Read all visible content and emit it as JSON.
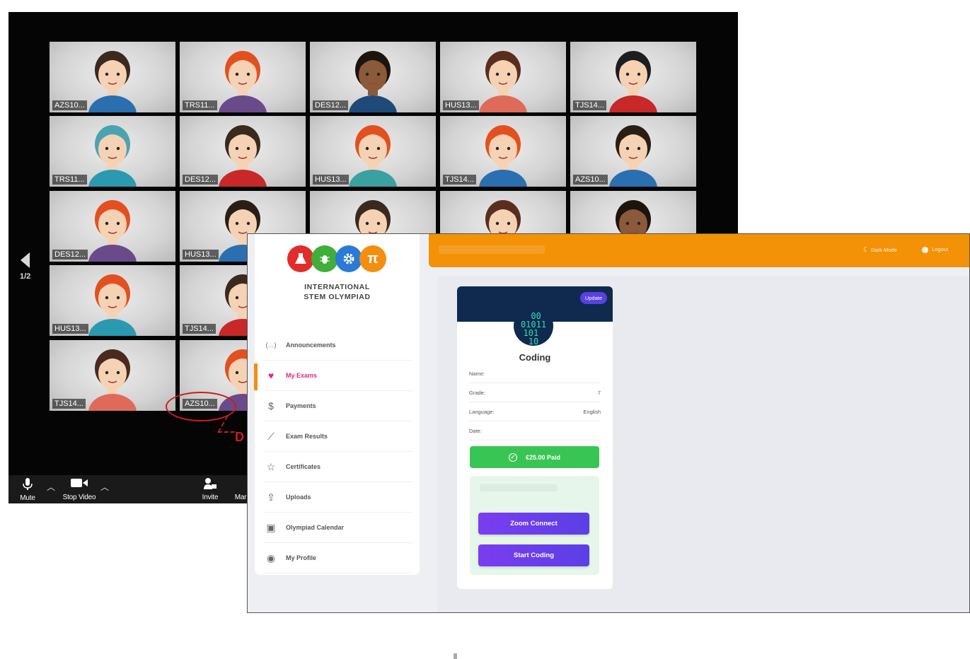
{
  "zoom": {
    "page_indicator": "1/2",
    "participants": [
      {
        "label": "AZS10..."
      },
      {
        "label": "TRS11..."
      },
      {
        "label": "DES12..."
      },
      {
        "label": "HUS13..."
      },
      {
        "label": "TJS14..."
      },
      {
        "label": "TRS11..."
      },
      {
        "label": "DES12..."
      },
      {
        "label": "HUS13..."
      },
      {
        "label": "TJS14..."
      },
      {
        "label": "AZS10..."
      },
      {
        "label": "DES12..."
      },
      {
        "label": "HUS13..."
      },
      {
        "label": ""
      },
      {
        "label": ""
      },
      {
        "label": ""
      },
      {
        "label": "HUS13..."
      },
      {
        "label": "TJS14..."
      },
      {
        "label": "TJS14..."
      },
      {
        "label": "AZS10..."
      }
    ],
    "annotation_letter": "D",
    "toolbar": {
      "mute": "Mute",
      "stop_video": "Stop Video",
      "invite": "Invite",
      "manage": "Mar"
    }
  },
  "portal": {
    "org_line1": "INTERNATIONAL",
    "org_line2": "STEM OLYMPIAD",
    "logo_pi": "π",
    "menu": [
      {
        "label": "Announcements",
        "icon": "chat-icon"
      },
      {
        "label": "My Exams",
        "icon": "heart-icon",
        "active": true
      },
      {
        "label": "Payments",
        "icon": "dollar-icon"
      },
      {
        "label": "Exam Results",
        "icon": "chart-icon"
      },
      {
        "label": "Certificates",
        "icon": "star-icon"
      },
      {
        "label": "Uploads",
        "icon": "upload-icon"
      },
      {
        "label": "Olympiad Calendar",
        "icon": "calendar-icon"
      },
      {
        "label": "My Profile",
        "icon": "user-icon"
      }
    ],
    "topbar": {
      "dark_mode": "Dark Mode",
      "logout": "Logout"
    },
    "card": {
      "update_label": "Update",
      "binary_art": "00 01011 101 10",
      "subject": "Coding",
      "rows": [
        {
          "label": "Name:",
          "value": ""
        },
        {
          "label": "Grade:",
          "value": "7"
        },
        {
          "label": "Language:",
          "value": "English"
        },
        {
          "label": "Date:",
          "value": ""
        }
      ],
      "paid_label": "€25.00 Paid",
      "zoom_connect": "Zoom Connect",
      "start_coding": "Start Coding"
    },
    "colors": {
      "accent": "#f39207",
      "active": "#e02b7b",
      "paid": "#39c553",
      "button": "#6a3ee8",
      "header": "#0f2a4e"
    }
  }
}
